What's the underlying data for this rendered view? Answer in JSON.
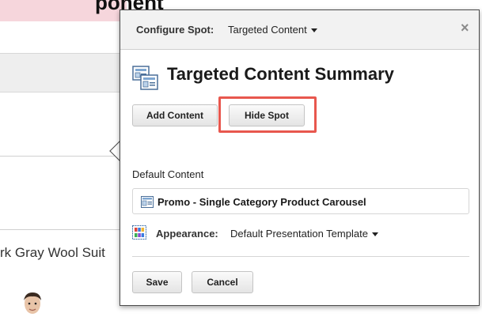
{
  "background": {
    "heading_fragment": "ponent",
    "product_name": "rk Gray Wool Suit"
  },
  "popover": {
    "header": {
      "label": "Configure Spot:",
      "value": "Targeted Content",
      "close_icon": "close-icon"
    },
    "summary_title": "Targeted Content Summary",
    "buttons": {
      "add_content": "Add Content",
      "hide_spot": "Hide Spot",
      "save": "Save",
      "cancel": "Cancel"
    },
    "default_content_label": "Default Content",
    "default_content_item": "Promo - Single Category Product Carousel",
    "appearance_label": "Appearance:",
    "appearance_value": "Default Presentation Template",
    "highlight_color": "#e8574e"
  }
}
